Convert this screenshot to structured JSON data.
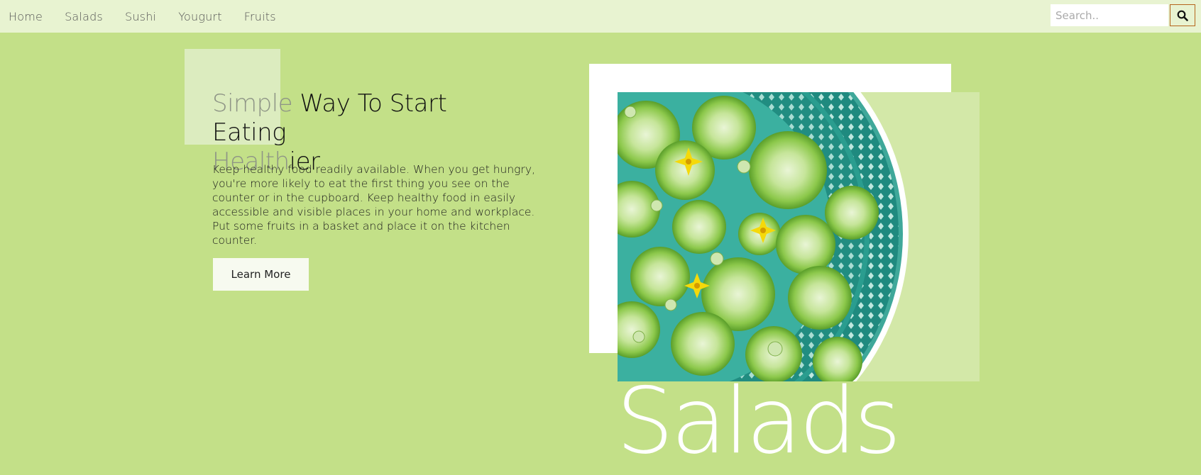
{
  "nav": {
    "items": [
      {
        "label": "Home"
      },
      {
        "label": "Salads"
      },
      {
        "label": "Sushi"
      },
      {
        "label": "Yougurt"
      },
      {
        "label": "Fruits"
      }
    ],
    "search_placeholder": "Search..",
    "search_icon": "search-icon"
  },
  "hero": {
    "title_muted_1": "Simple",
    "title_dark_1": " Way To Start Eating",
    "title_muted_2": "Health",
    "title_dark_2": "ier",
    "description": "Keep healthy food readily available. When you get hungry, you're more likely to eat the first thing you see on the counter or in the cupboard. Keep healthy food in easily accessible and visible places in your home and workplace. Put some fruits in a basket and place it on the kitchen counter.",
    "button_label": "Learn More"
  },
  "feature": {
    "big_word": "Salads"
  },
  "colors": {
    "page_background": "#c3e088",
    "navbar_background": "#e8f3d1",
    "accent_border": "#b5651d",
    "plate_teal": "#2a9d8f",
    "tomato_green": "#8cc84b",
    "flower_yellow": "#f5d90a"
  }
}
